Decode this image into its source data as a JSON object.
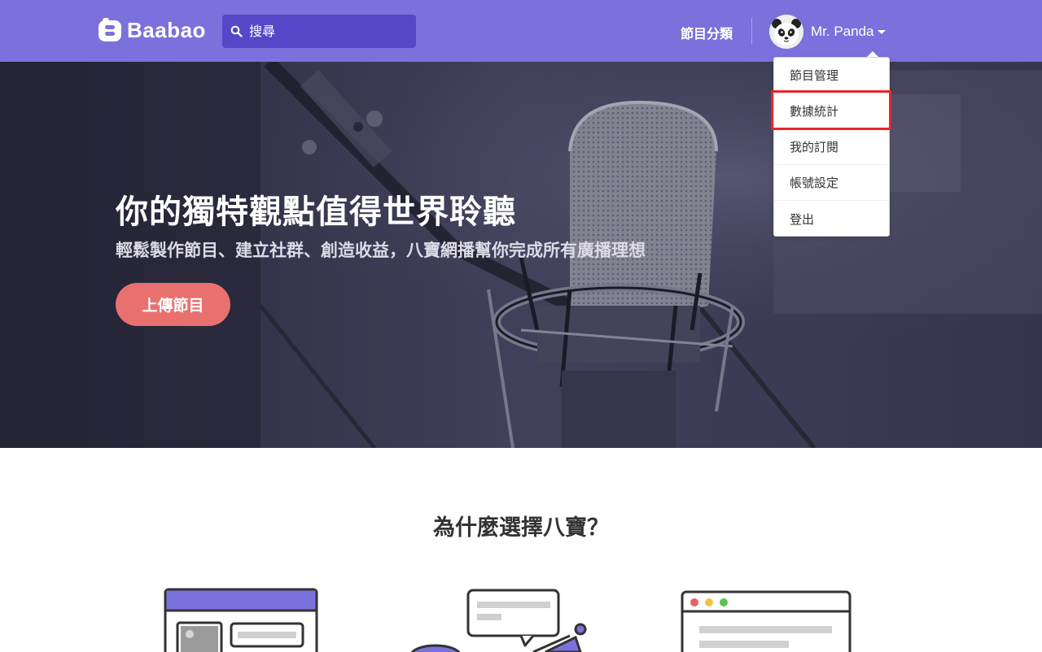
{
  "brand": {
    "name": "Baabao",
    "nav_color": "#7b71dc",
    "accent": "#e8716f"
  },
  "search": {
    "placeholder": "搜尋"
  },
  "nav": {
    "categories_label": "節目分類"
  },
  "user": {
    "name": "Mr. Panda"
  },
  "dropdown": {
    "items": [
      {
        "label": "節目管理"
      },
      {
        "label": "數據統計",
        "highlighted": true
      },
      {
        "label": "我的訂閱"
      },
      {
        "label": "帳號設定"
      },
      {
        "label": "登出"
      }
    ]
  },
  "hero": {
    "title": "你的獨特觀點值得世界聆聽",
    "subtitle": "輕鬆製作節目、建立社群、創造收益，八寶網播幫你完成所有廣播理想",
    "cta_label": "上傳節目"
  },
  "features": {
    "title": "為什麼選擇八寶？"
  }
}
